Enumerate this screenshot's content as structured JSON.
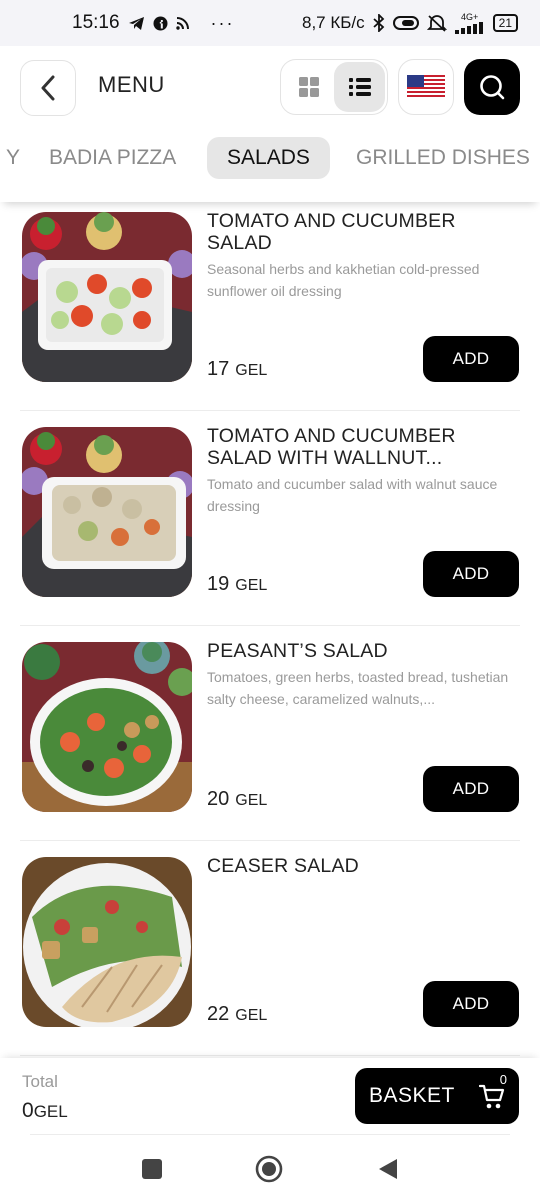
{
  "status_bar": {
    "time": "15:16",
    "dots": "···",
    "network_speed": "8,7 КБ/с",
    "signal": "4G+",
    "battery": "21"
  },
  "header": {
    "title": "MENU",
    "back_icon": "chevron-left-icon",
    "grid_icon": "grid-view-icon",
    "list_icon": "list-view-icon",
    "language_icon": "us-flag-icon",
    "search_icon": "search-icon"
  },
  "tabs": [
    {
      "label": "Y",
      "active": false
    },
    {
      "label": "BADIA PIZZA",
      "active": false
    },
    {
      "label": "SALADS",
      "active": true
    },
    {
      "label": "GRILLED DISHES",
      "active": false
    }
  ],
  "items": [
    {
      "name": "TOMATO AND CUCUMBER SALAD",
      "description": "Seasonal herbs and kakhetian cold-pressed sunflower oil dressing",
      "price": "17",
      "currency": "GEL",
      "add_label": "ADD"
    },
    {
      "name": "TOMATO AND CUCUMBER SALAD WITH WALLNUT...",
      "description": "Tomato and cucumber salad with walnut sauce dressing",
      "price": "19",
      "currency": "GEL",
      "add_label": "ADD"
    },
    {
      "name": "PEASANT’S SALAD",
      "description": "Tomatoes, green herbs, toasted bread, tushetian salty cheese, caramelized walnuts,...",
      "price": "20",
      "currency": "GEL",
      "add_label": "ADD"
    },
    {
      "name": "CEASER SALAD",
      "description": "",
      "price": "22",
      "currency": "GEL",
      "add_label": "ADD"
    }
  ],
  "footer": {
    "total_label": "Total",
    "total_value": "0",
    "total_currency": "GEL",
    "basket_label": "BASKET",
    "basket_count": "0",
    "cart_icon": "cart-icon"
  },
  "nav": {
    "recents_icon": "square-icon",
    "home_icon": "circle-home-icon",
    "back_icon": "triangle-back-icon"
  },
  "colors": {
    "accent": "#000000",
    "tab_active_bg": "#e6e6e6",
    "muted_text": "#9a9a9a"
  }
}
